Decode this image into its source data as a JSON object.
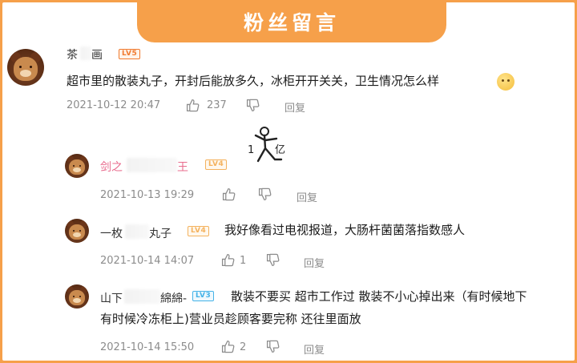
{
  "header": {
    "title": "粉丝留言"
  },
  "comments": [
    {
      "name_first": "茶",
      "name_last": "画",
      "level": "LV5",
      "text": "超市里的散装丸子，开封后能放多久，冰柜开开关关，卫生情况怎么样",
      "date": "2021-10-12 20:47",
      "likes": "237",
      "reply_label": "回复"
    }
  ],
  "replies": [
    {
      "name_first": "剑之",
      "name_last": "王",
      "level": "LV4",
      "text": "",
      "date": "2021-10-13 19:29",
      "likes": "",
      "reply_label": "回复",
      "sticker_text_a": "1",
      "sticker_text_b": "亿"
    },
    {
      "name_first": "一枚",
      "name_last": "丸子",
      "level": "LV4",
      "text": "我好像看过电视报道，大肠杆菌菌落指数感人",
      "date": "2021-10-14 14:07",
      "likes": "1",
      "reply_label": "回复"
    },
    {
      "name_first": "山下",
      "name_last": "綿綿-",
      "level": "LV3",
      "text_line1": "散装不要买 超市工作过 散装不小心掉出来（有时候地下",
      "text_line2": "有时候冷冻柜上)营业员趁顾客要完称 还往里面放",
      "date": "2021-10-14 15:50",
      "likes": "2",
      "reply_label": "回复"
    }
  ],
  "colors": {
    "accent": "#f6a04a",
    "pink_name": "#e86c8e",
    "lv5": "#f07a2e",
    "lv4": "#f4b25e",
    "lv3": "#45b3e8"
  }
}
